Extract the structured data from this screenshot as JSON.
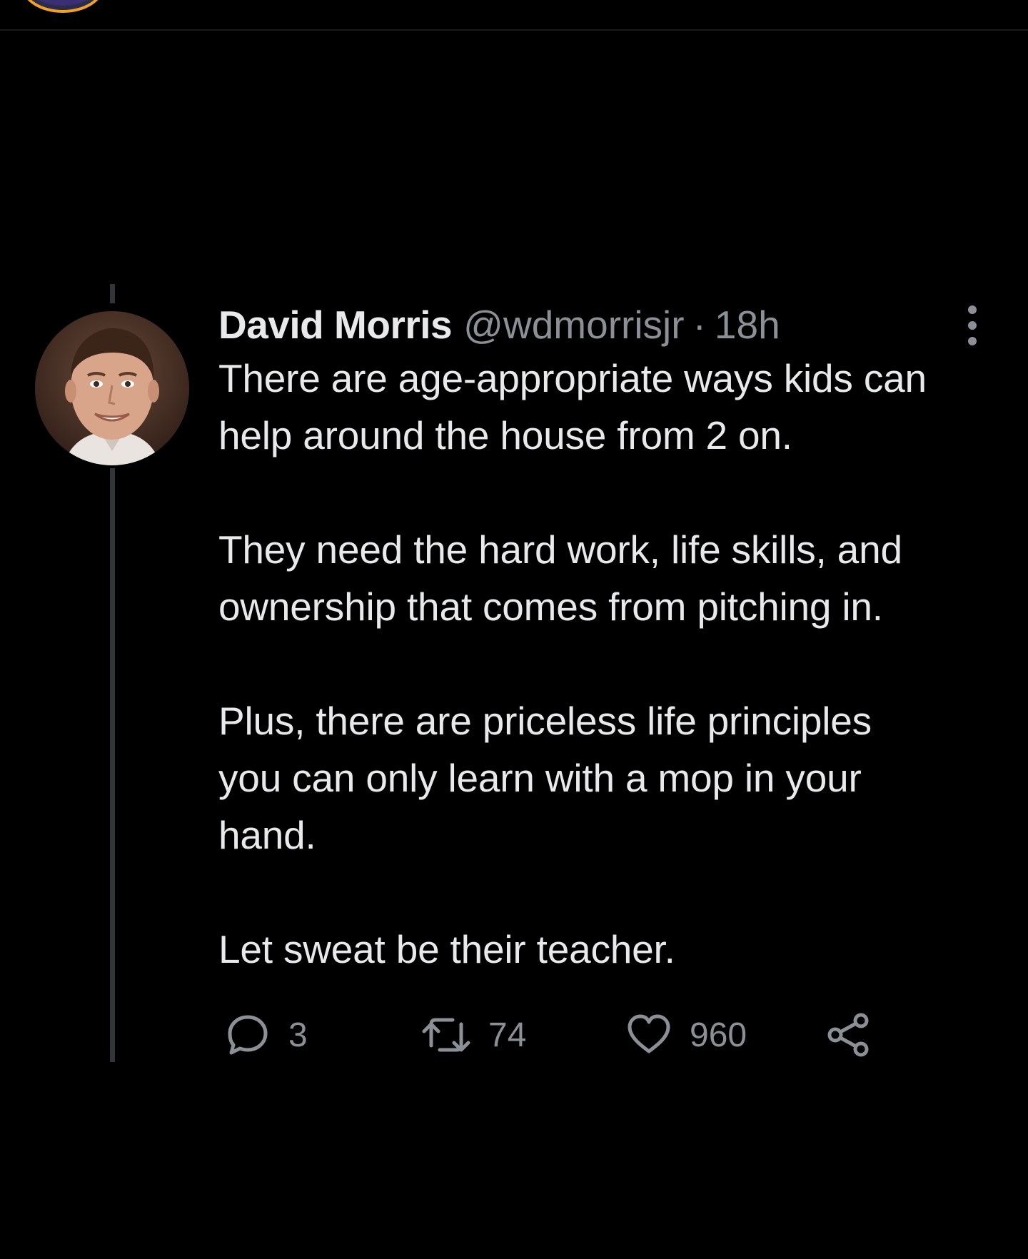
{
  "tweet": {
    "author_name": "David Morris",
    "author_handle": "@wdmorrisjr",
    "separator": "·",
    "timestamp": "18h",
    "paragraphs": [
      "There are age-appropriate ways kids can\nhelp around the house from 2 on.",
      "They need the hard work, life skills, and\nownership that comes from pitching in.",
      "Plus, there are priceless life principles\nyou can only learn with a mop in your\nhand.",
      "Let sweat be their teacher."
    ],
    "actions": {
      "reply_count": "3",
      "retweet_count": "74",
      "like_count": "960"
    }
  },
  "icons": {
    "more": "more-vertical-icon",
    "reply": "reply-icon",
    "retweet": "retweet-icon",
    "like": "heart-icon",
    "share": "share-icon"
  },
  "colors": {
    "background": "#000000",
    "text": "#e7e9ea",
    "muted": "#8b9096",
    "thread_line": "#333639",
    "story_ring": "#f4a21e"
  }
}
